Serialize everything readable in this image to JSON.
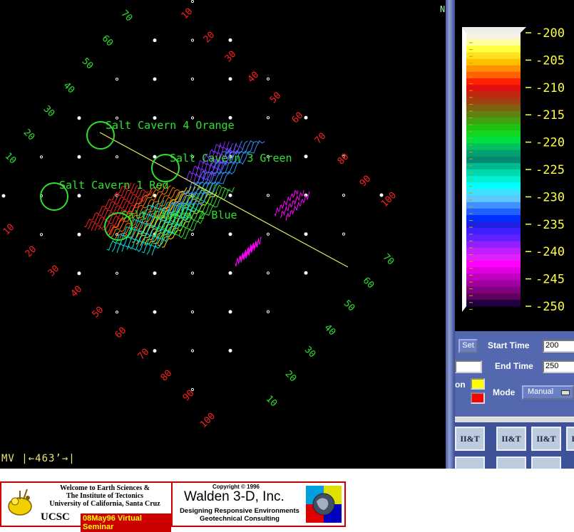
{
  "visualization": {
    "scale_readout": "MV |←463’→|",
    "cavern_labels": [
      "Salt Cavern 4 Orange",
      "Salt Cavern 3 Green",
      "Salt Cavern 1 Red",
      "Salt Cavern 2 Blue"
    ],
    "axis_upper_left_green": [
      "70",
      "60",
      "50",
      "40",
      "30",
      "20",
      "10"
    ],
    "axis_upper_right_red": [
      "10",
      "20",
      "30",
      "40",
      "50",
      "60",
      "70",
      "80",
      "90",
      "100"
    ],
    "axis_lower_left_red": [
      "10",
      "20",
      "30",
      "40",
      "50",
      "60",
      "70",
      "80",
      "90",
      "100"
    ],
    "axis_lower_right_green": [
      "70",
      "60",
      "50",
      "40",
      "30",
      "20",
      "10"
    ]
  },
  "colorbar": {
    "tick_labels": [
      "-200",
      "-205",
      "-210",
      "-215",
      "-220",
      "-225",
      "-230",
      "-235",
      "-240",
      "-245",
      "-250"
    ],
    "colors": [
      "#f8f0e0",
      "#ffffa0",
      "#ffff40",
      "#ffe020",
      "#ffc000",
      "#ff9000",
      "#ff6000",
      "#ff2000",
      "#e01010",
      "#c02810",
      "#a04010",
      "#806010",
      "#608010",
      "#40a010",
      "#20c010",
      "#10d820",
      "#00e040",
      "#00c060",
      "#00a070",
      "#008870",
      "#00b890",
      "#00d8b0",
      "#00f0d0",
      "#00ffff",
      "#40e0ff",
      "#60c8ff",
      "#4090ff",
      "#2060ff",
      "#0030ff",
      "#2020e0",
      "#4020ff",
      "#6020ff",
      "#9020ff",
      "#c020ff",
      "#e020ff",
      "#ff00ff",
      "#e000e0",
      "#c000c0",
      "#a000a0",
      "#800080",
      "#600060",
      "#200040"
    ]
  },
  "controls": {
    "set_button": "Set",
    "start_time_label": "Start Time",
    "start_time_value": "200",
    "end_time_label": "End Time",
    "end_time_value": "250",
    "color_label_fragment": "on",
    "swatch_top_color": "#ffff00",
    "swatch_bottom_color": "#ff0000",
    "mode_label": "Mode",
    "mode_value": "Manual"
  },
  "logo_tile_text": "II&T",
  "banner": {
    "welcome_line1": "Welcome to Earth Sciences &",
    "welcome_line2": "The Institute of Tectonics",
    "welcome_line3": "University of California, Santa Cruz",
    "ucsc": "UCSC",
    "seminar": "08May96 Virtual Seminar",
    "copyright": "Copyright © 1996",
    "company": "Walden 3-D, Inc.",
    "tagline1": "Designing Responsive Environments",
    "tagline2": "Geotechnical Consulting"
  }
}
